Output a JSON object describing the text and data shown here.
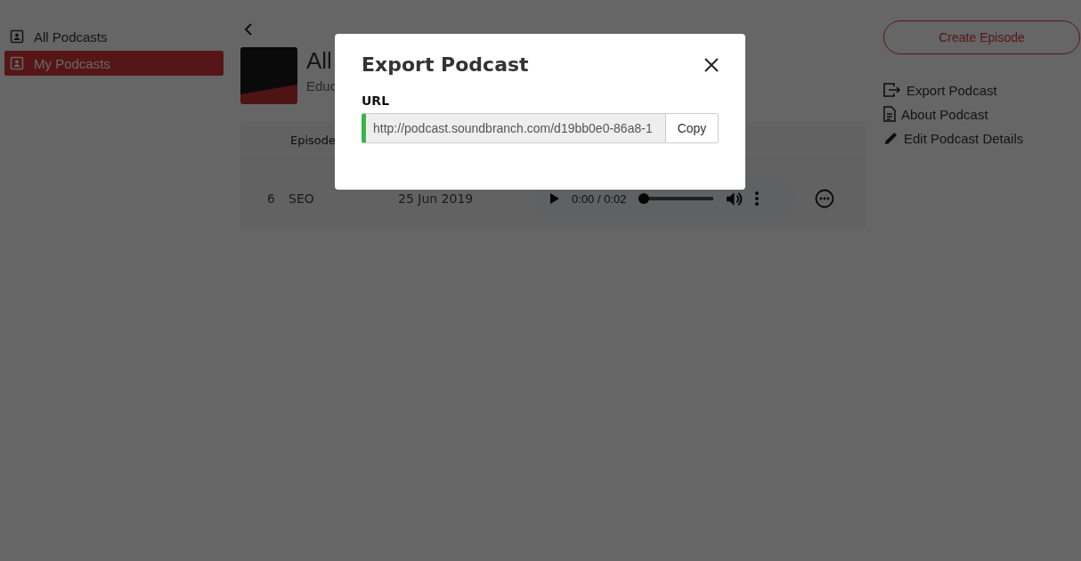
{
  "sidebar": {
    "items": [
      {
        "label": "All Podcasts",
        "selected": false
      },
      {
        "label": "My Podcasts",
        "selected": true
      }
    ]
  },
  "podcast": {
    "title": "All",
    "subtitle": "Educ"
  },
  "table": {
    "columns": [
      "Episode"
    ],
    "rows": [
      {
        "number": "6",
        "title": "SEO",
        "date": "25 Jun 2019",
        "player": {
          "time": "0:00 / 0:02",
          "level": 0
        }
      }
    ]
  },
  "actions": {
    "create_button": "Create Episode",
    "links": [
      {
        "kind": "export",
        "label": "Export Podcast"
      },
      {
        "kind": "about",
        "label": "About Podcast"
      },
      {
        "kind": "edit",
        "label": "Edit Podcast Details"
      }
    ]
  },
  "modal": {
    "title": "Export Podcast",
    "field_label": "URL",
    "url": "http://podcast.soundbranch.com/d19bb0e0-86a8-1",
    "copy_button": "Copy"
  }
}
